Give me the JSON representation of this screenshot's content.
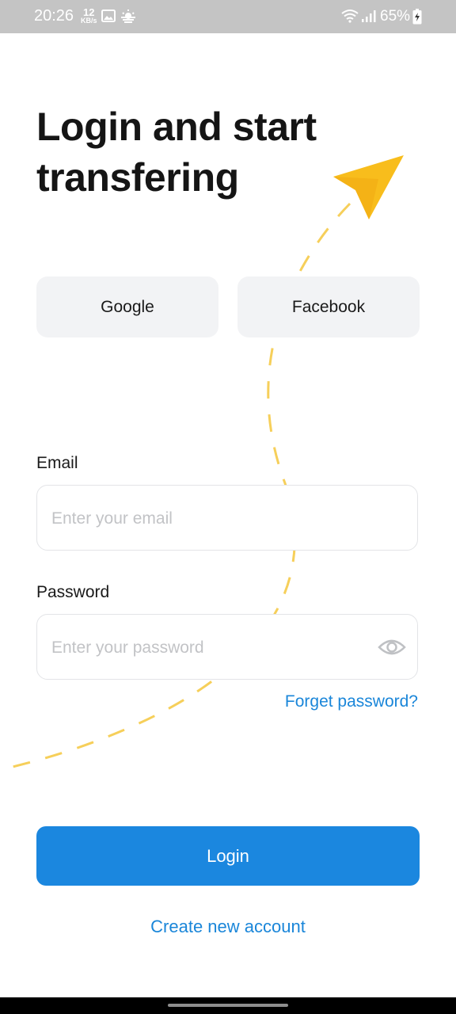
{
  "status_bar": {
    "time": "20:26",
    "speed_value": "12",
    "speed_unit": "KB/s",
    "battery": "65%",
    "icons": [
      "image-icon",
      "weather-icon",
      "wifi-icon",
      "signal-icon",
      "battery-icon"
    ]
  },
  "title": "Login and start transfering",
  "social": {
    "google": "Google",
    "facebook": "Facebook"
  },
  "form": {
    "email_label": "Email",
    "email_placeholder": "Enter your email",
    "email_value": "",
    "password_label": "Password",
    "password_placeholder": "Enter your password",
    "password_value": "",
    "forget_password": "Forget password?"
  },
  "actions": {
    "login": "Login",
    "create_account": "Create new account"
  },
  "colors": {
    "accent": "#1b87df",
    "link": "#1a86d9",
    "plane": "#f8bd1c",
    "social_bg": "#f2f3f5"
  }
}
